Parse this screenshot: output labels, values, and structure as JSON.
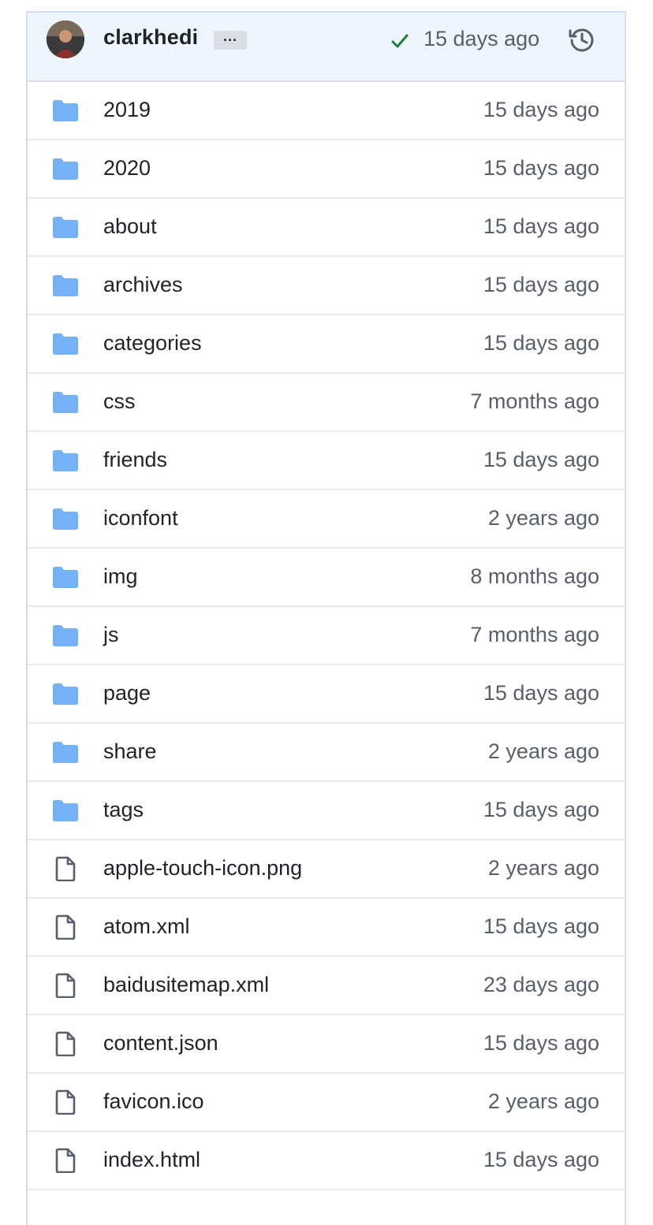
{
  "commit": {
    "author": "clarkhedi",
    "ellipsis_label": "···",
    "time": "15 days ago",
    "colors": {
      "check": "#1a7f37",
      "bar_background": "#eef5fe"
    },
    "icons": [
      "avatar",
      "ellipsis-icon",
      "check-icon",
      "history-icon"
    ]
  },
  "files": [
    {
      "type": "folder",
      "name": "2019",
      "age": "15 days ago"
    },
    {
      "type": "folder",
      "name": "2020",
      "age": "15 days ago"
    },
    {
      "type": "folder",
      "name": "about",
      "age": "15 days ago"
    },
    {
      "type": "folder",
      "name": "archives",
      "age": "15 days ago"
    },
    {
      "type": "folder",
      "name": "categories",
      "age": "15 days ago"
    },
    {
      "type": "folder",
      "name": "css",
      "age": "7 months ago"
    },
    {
      "type": "folder",
      "name": "friends",
      "age": "15 days ago"
    },
    {
      "type": "folder",
      "name": "iconfont",
      "age": "2 years ago"
    },
    {
      "type": "folder",
      "name": "img",
      "age": "8 months ago"
    },
    {
      "type": "folder",
      "name": "js",
      "age": "7 months ago"
    },
    {
      "type": "folder",
      "name": "page",
      "age": "15 days ago"
    },
    {
      "type": "folder",
      "name": "share",
      "age": "2 years ago"
    },
    {
      "type": "folder",
      "name": "tags",
      "age": "15 days ago"
    },
    {
      "type": "file",
      "name": "apple-touch-icon.png",
      "age": "2 years ago"
    },
    {
      "type": "file",
      "name": "atom.xml",
      "age": "15 days ago"
    },
    {
      "type": "file",
      "name": "baidusitemap.xml",
      "age": "23 days ago"
    },
    {
      "type": "file",
      "name": "content.json",
      "age": "15 days ago"
    },
    {
      "type": "file",
      "name": "favicon.ico",
      "age": "2 years ago"
    },
    {
      "type": "file",
      "name": "index.html",
      "age": "15 days ago"
    }
  ],
  "colors": {
    "folder": "#74b1f7",
    "file_outline": "#57606a",
    "text_primary": "#1f2328",
    "text_muted": "#57606a"
  }
}
